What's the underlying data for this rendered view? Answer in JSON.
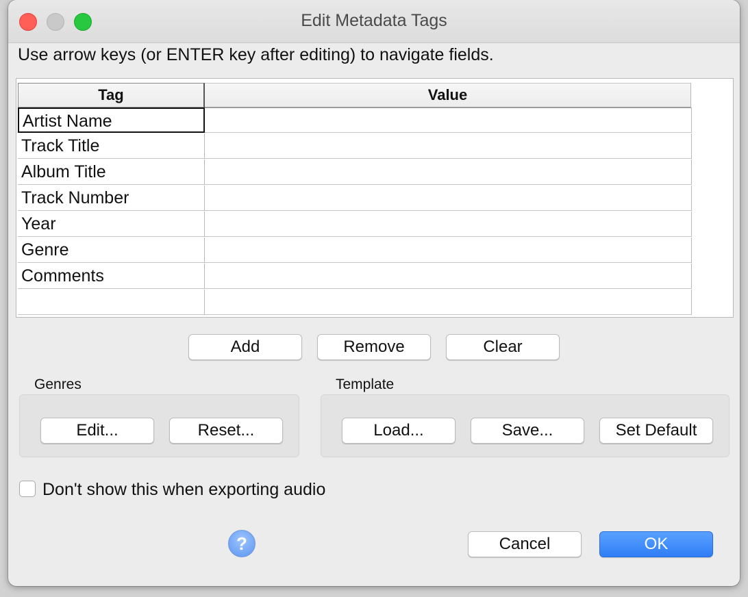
{
  "window": {
    "title": "Edit Metadata Tags"
  },
  "instructions": "Use arrow keys (or ENTER key after editing) to navigate fields.",
  "table": {
    "headers": {
      "tag": "Tag",
      "value": "Value"
    },
    "rows": [
      {
        "tag": "Artist Name",
        "value": ""
      },
      {
        "tag": "Track Title",
        "value": ""
      },
      {
        "tag": "Album Title",
        "value": ""
      },
      {
        "tag": "Track Number",
        "value": ""
      },
      {
        "tag": "Year",
        "value": ""
      },
      {
        "tag": "Genre",
        "value": ""
      },
      {
        "tag": "Comments",
        "value": ""
      },
      {
        "tag": "",
        "value": ""
      }
    ]
  },
  "table_actions": {
    "add": "Add",
    "remove": "Remove",
    "clear": "Clear"
  },
  "genres": {
    "label": "Genres",
    "edit": "Edit...",
    "reset": "Reset..."
  },
  "template": {
    "label": "Template",
    "load": "Load...",
    "save": "Save...",
    "set_default": "Set Default"
  },
  "options": {
    "dont_show_label": "Don't show this when exporting audio",
    "dont_show_checked": false
  },
  "footer": {
    "help_glyph": "?",
    "cancel": "Cancel",
    "ok": "OK"
  },
  "colors": {
    "ok_accent": "#2f7df6",
    "close": "#ff5f57",
    "maximize": "#28c840",
    "help": "#5b95f0"
  }
}
